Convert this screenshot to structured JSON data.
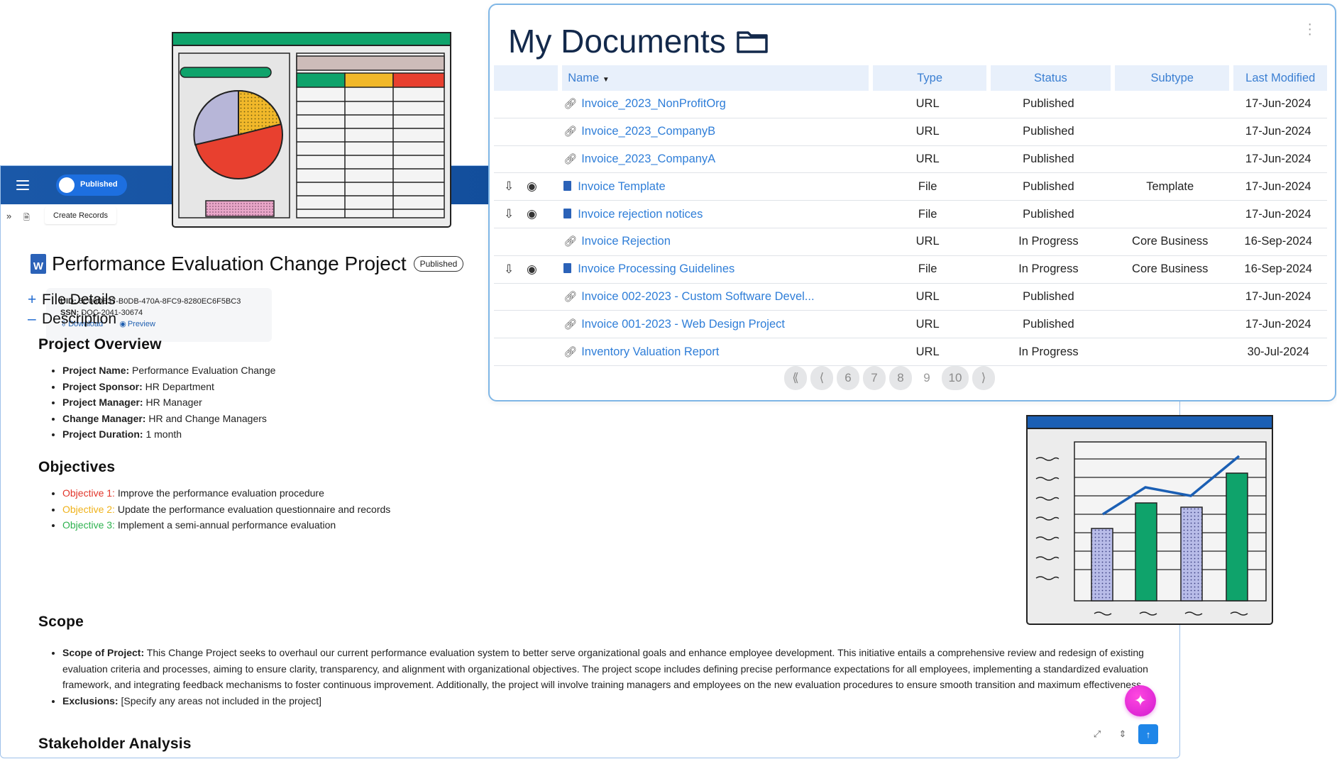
{
  "doc_panel": {
    "status_toggle": "Published",
    "create_records": "Create Records",
    "title": "Performance Evaluation Change Project",
    "status_badge": "Published",
    "meta": {
      "uid_label": "UID:",
      "uid": "6C06D837-B0DB-470A-8FC9-8280EC6F5BC3",
      "ssn_label": "SSN:",
      "ssn": "DOC-2041-30674",
      "download": "Download",
      "preview": "Preview"
    },
    "sections": {
      "file_details": "File Details",
      "description": "Description"
    },
    "overview": {
      "heading": "Project Overview",
      "items": [
        {
          "label": "Project Name:",
          "value": " Performance Evaluation Change"
        },
        {
          "label": "Project Sponsor:",
          "value": " HR Department"
        },
        {
          "label": "Project Manager:",
          "value": " HR Manager"
        },
        {
          "label": "Change Manager:",
          "value": " HR and Change Managers"
        },
        {
          "label": "Project Duration:",
          "value": " 1 month"
        }
      ]
    },
    "objectives": {
      "heading": "Objectives",
      "items": [
        {
          "label": "Objective 1:",
          "value": " Improve the performance evaluation procedure",
          "color": "#e2362b"
        },
        {
          "label": "Objective 2:",
          "value": " Update the performance evaluation questionnaire and records",
          "color": "#efb21b"
        },
        {
          "label": "Objective 3:",
          "value": " Implement a semi-annual performance evaluation",
          "color": "#2eb24f"
        }
      ]
    },
    "scope": {
      "heading": "Scope",
      "scope_label": "Scope of Project:",
      "scope_text": " This Change Project seeks to overhaul our current performance evaluation system to better serve organizational goals and enhance employee development. This initiative entails a comprehensive review and redesign of existing evaluation criteria and processes, aiming to ensure clarity, transparency, and alignment with organizational objectives. The project scope includes defining precise performance expectations for all employees, implementing a standardized evaluation framework, and integrating feedback mechanisms to foster continuous improvement. Additionally, the project will involve training managers and employees on the new evaluation procedures to ensure smooth transition and maximum effectiveness.",
      "exclusions_label": "Exclusions:",
      "exclusions_text": " [Specify any areas not included in the project]"
    },
    "stakeholder_heading": "Stakeholder Analysis"
  },
  "my_documents": {
    "title": "My Documents",
    "columns": [
      "Name",
      "Type",
      "Status",
      "Subtype",
      "Last Modified"
    ],
    "rows": [
      {
        "name": "Invoice_2023_NonProfitOrg",
        "type": "URL",
        "status": "Published",
        "subtype": "",
        "modified": "17-Jun-2024",
        "kind": "link"
      },
      {
        "name": "Invoice_2023_CompanyB",
        "type": "URL",
        "status": "Published",
        "subtype": "",
        "modified": "17-Jun-2024",
        "kind": "link"
      },
      {
        "name": "Invoice_2023_CompanyA",
        "type": "URL",
        "status": "Published",
        "subtype": "",
        "modified": "17-Jun-2024",
        "kind": "link"
      },
      {
        "name": "Invoice Template",
        "type": "File",
        "status": "Published",
        "subtype": "Template",
        "modified": "17-Jun-2024",
        "kind": "file"
      },
      {
        "name": "Invoice rejection notices",
        "type": "File",
        "status": "Published",
        "subtype": "",
        "modified": "17-Jun-2024",
        "kind": "file"
      },
      {
        "name": "Invoice Rejection",
        "type": "URL",
        "status": "In Progress",
        "subtype": "Core Business",
        "modified": "16-Sep-2024",
        "kind": "link"
      },
      {
        "name": "Invoice Processing Guidelines",
        "type": "File",
        "status": "In Progress",
        "subtype": "Core Business",
        "modified": "16-Sep-2024",
        "kind": "file"
      },
      {
        "name": "Invoice 002-2023 - Custom Software Devel...",
        "type": "URL",
        "status": "Published",
        "subtype": "",
        "modified": "17-Jun-2024",
        "kind": "link"
      },
      {
        "name": "Invoice 001-2023 - Web Design Project",
        "type": "URL",
        "status": "Published",
        "subtype": "",
        "modified": "17-Jun-2024",
        "kind": "link"
      },
      {
        "name": "Inventory Valuation Report",
        "type": "URL",
        "status": "In Progress",
        "subtype": "",
        "modified": "30-Jul-2024",
        "kind": "link"
      }
    ],
    "pagination": {
      "first": "⟪",
      "prev": "⟨",
      "pages": [
        "6",
        "7",
        "8",
        "9",
        "10"
      ],
      "current": "9",
      "next": "⟩"
    }
  },
  "icons": {
    "menu": "hamburger-icon",
    "expand": "double-chevron-icon",
    "doc": "document-icon",
    "word": "word-file-icon",
    "download": "download-icon",
    "preview": "eye-icon",
    "link": "link-icon",
    "folder": "folder-icon",
    "assistant": "sparkle-icon"
  },
  "colors": {
    "brand_blue": "#0f4a97",
    "link_blue": "#2f7ed8",
    "header_bg": "#e8f0fb",
    "accent_green": "#0fa36b",
    "accent_red": "#e8402f",
    "accent_yellow": "#f1b82a",
    "assistant_pink": "#d11ad0"
  }
}
